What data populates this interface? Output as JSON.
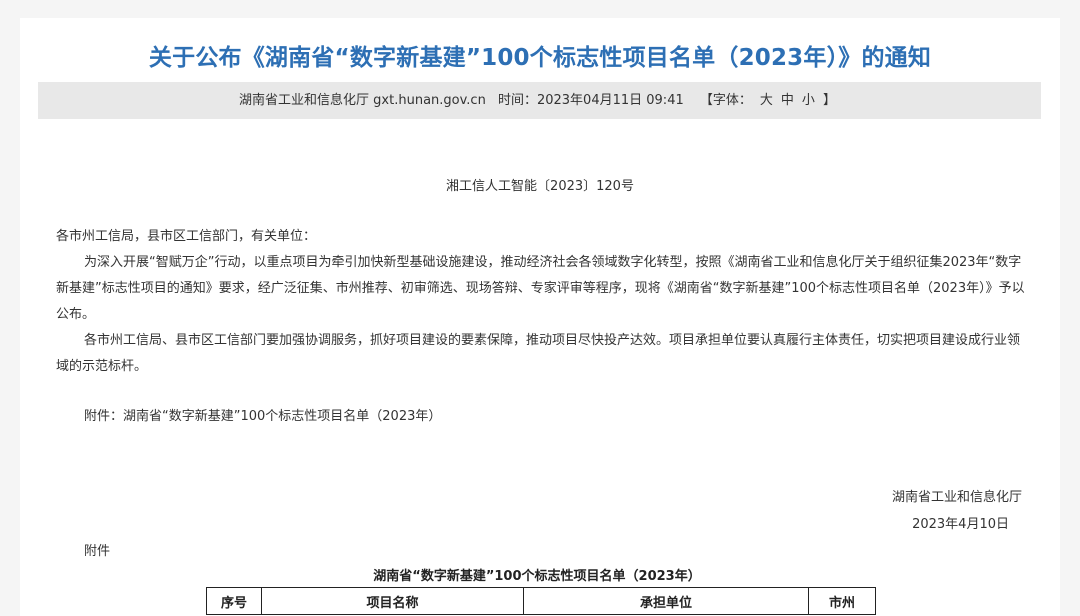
{
  "article": {
    "title": "关于公布《湖南省“数字新基建”100个标志性项目名单（2023年）》的通知",
    "meta": {
      "source": "湖南省工业和信息化厅 gxt.hunan.gov.cn",
      "time": "时间：2023年04月11日 09:41",
      "font_label": "【字体：",
      "font_large": "大",
      "font_medium": "中",
      "font_small": "小",
      "font_close": "】"
    },
    "doc_number": "湘工信人工智能〔2023〕120号",
    "salutation": "各市州工信局，县市区工信部门，有关单位：",
    "paragraph1": "为深入开展“智赋万企”行动，以重点项目为牵引加快新型基础设施建设，推动经济社会各领域数字化转型，按照《湖南省工业和信息化厅关于组织征集2023年“数字新基建”标志性项目的通知》要求，经广泛征集、市州推荐、初审筛选、现场答辩、专家评审等程序，现将《湖南省“数字新基建”100个标志性项目名单（2023年）》予以公布。",
    "paragraph2": "各市州工信局、县市区工信部门要加强协调服务，抓好项目建设的要素保障，推动项目尽快投产达效。项目承担单位要认真履行主体责任，切实把项目建设成行业领域的示范标杆。",
    "attachment_ref": "附件：湖南省“数字新基建”100个标志性项目名单（2023年）",
    "signature_org": "湖南省工业和信息化厅",
    "signature_date": "2023年4月10日",
    "attachment_label": "附件",
    "table_title": "湖南省“数字新基建”100个标志性项目名单（2023年）",
    "table_headers": [
      "序号",
      "项目名称",
      "承担单位",
      "市州"
    ]
  }
}
